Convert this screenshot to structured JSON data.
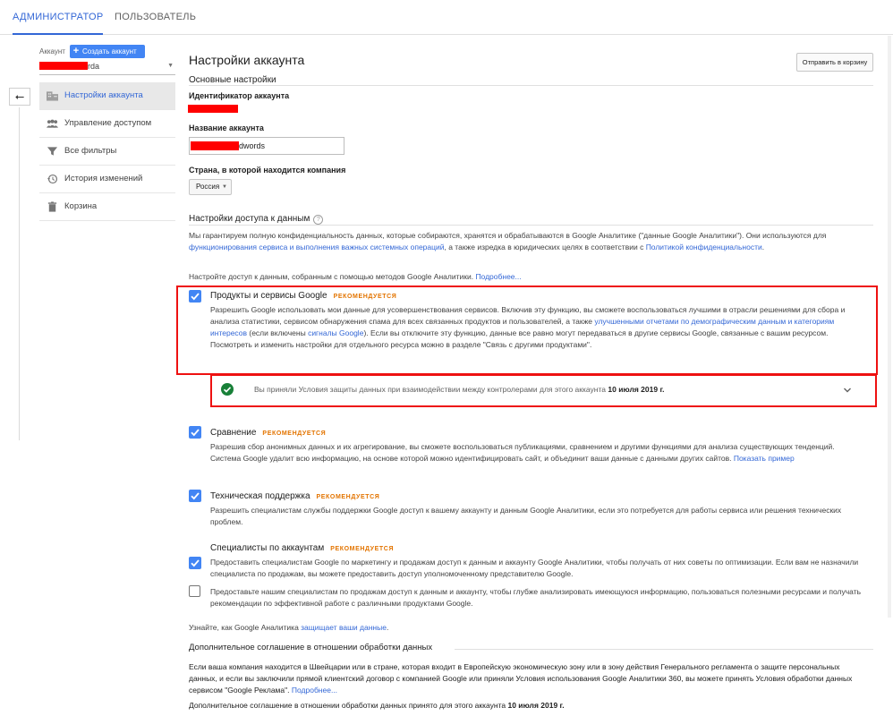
{
  "topbar": {
    "tab_admin": "АДМИНИСТРАТОР",
    "tab_user": "ПОЛЬЗОВАТЕЛЬ"
  },
  "sidebar": {
    "account_label": "Аккаунт",
    "create_button": "Создать аккаунт",
    "account_value": "rda",
    "items": [
      {
        "label": "Настройки аккаунта",
        "icon": "building-icon",
        "active": true
      },
      {
        "label": "Управление доступом",
        "icon": "people-icon",
        "active": false
      },
      {
        "label": "Все фильтры",
        "icon": "filter-icon",
        "active": false
      },
      {
        "label": "История изменений",
        "icon": "history-icon",
        "active": false
      },
      {
        "label": "Корзина",
        "icon": "trash-icon",
        "active": false
      }
    ]
  },
  "main": {
    "title": "Настройки аккаунта",
    "trash_button": "Отправить в корзину",
    "basic_settings": "Основные настройки",
    "account_id_label": "Идентификатор аккаунта",
    "account_name_label": "Название аккаунта",
    "account_name_value": "dwords",
    "country_label": "Страна, в которой находится компания",
    "country_value": "Россия",
    "data_access_heading": "Настройки доступа к данным",
    "guarantee_text_1": "Мы гарантируем полную конфиденциальность данных, которые собираются, хранятся и обрабатываются в Google Аналитике (\"данные Google Аналитики\"). Они используются для ",
    "guarantee_link_1": "функционирования сервиса и выполнения важных системных операций",
    "guarantee_text_2": ", а также изредка в юридических целях в соответствии с ",
    "guarantee_link_2": "Политикой конфиденциальности",
    "guarantee_text_3": ".",
    "configure_text": "Настройте доступ к данным, собранным с помощью методов Google Аналитики. ",
    "configure_link": "Подробнее...",
    "recommended": "РЕКОМЕНДУЕТСЯ",
    "opt_products": {
      "title": "Продукты и сервисы Google",
      "desc_1": "Разрешить Google использовать мои данные для усовершенствования сервисов. Включив эту функцию, вы сможете воспользоваться лучшими в отрасли решениями для сбора и анализа статистики, сервисом обнаружения спама для всех связанных продуктов и пользователей, а также ",
      "desc_link_1": "улучшенными отчетами по демографическим данным и категориям интересов",
      "desc_2": " (если включены ",
      "desc_link_2": "сигналы Google",
      "desc_3": "). Если вы отключите эту функцию, данные все равно могут передаваться в другие сервисы Google, связанные с вашим ресурсом. Посмотреть и изменить настройки для отдельного ресурса можно в разделе \"Связь с другими продуктами\"."
    },
    "terms_notice": "Вы приняли Условия защиты данных при взаимодействии между контролерами для этого аккаунта ",
    "terms_date": "10 июля 2019 г.",
    "opt_benchmark": {
      "title": "Сравнение",
      "desc": "Разрешив сбор анонимных данных и их агрегирование, вы сможете воспользоваться публикациями, сравнением и другими функциями для анализа существующих тенденций. Система Google удалит всю информацию, на основе которой можно идентифицировать сайт, и объединит ваши данные с данными других сайтов. ",
      "link": "Показать пример"
    },
    "opt_support": {
      "title": "Техническая поддержка",
      "desc": "Разрешить специалистам службы поддержки Google доступ к вашему аккаунту и данным Google Аналитики, если это потребуется для работы сервиса или решения технических проблем."
    },
    "opt_specialists": {
      "title": "Специалисты по аккаунтам",
      "desc_1": "Предоставить специалистам Google по маркетингу и продажам доступ к данным и аккаунту Google Аналитики, чтобы получать от них советы по оптимизации. Если вам не назначили специалиста по продажам, вы можете предоставить доступ уполномоченному представителю Google.",
      "desc_2": "Предоставьте нашим специалистам по продажам доступ к данным и аккаунту, чтобы глубже анализировать имеющуюся информацию, пользоваться полезными ресурсами и получать рекомендации по эффективной работе с различными продуктами Google."
    },
    "protect_text": "Узнайте, как Google Аналитика ",
    "protect_link": "защищает ваши данные",
    "protect_end": ".",
    "amendment_heading": "Дополнительное соглашение в отношении обработки данных",
    "amendment_text": "Если ваша компания находится в Швейцарии или в стране, которая входит в Европейскую экономическую зону или в зону действия Генерального регламента о защите персональных данных, и если вы заключили прямой клиентский договор с компанией Google или приняли Условия использования Google Аналитики 360, вы можете принять Условия обработки данных сервисом \"Google Реклама\". ",
    "amendment_link": "Подробнее...",
    "amendment_accepted": "Дополнительное соглашение в отношении обработки данных принято для этого аккаунта ",
    "amendment_date": "10 июля 2019 г.",
    "colors": {
      "accent": "#4285f4",
      "link": "#3367d6",
      "recommended": "#e37400",
      "highlight": "#ee1111",
      "success": "#188038"
    }
  }
}
